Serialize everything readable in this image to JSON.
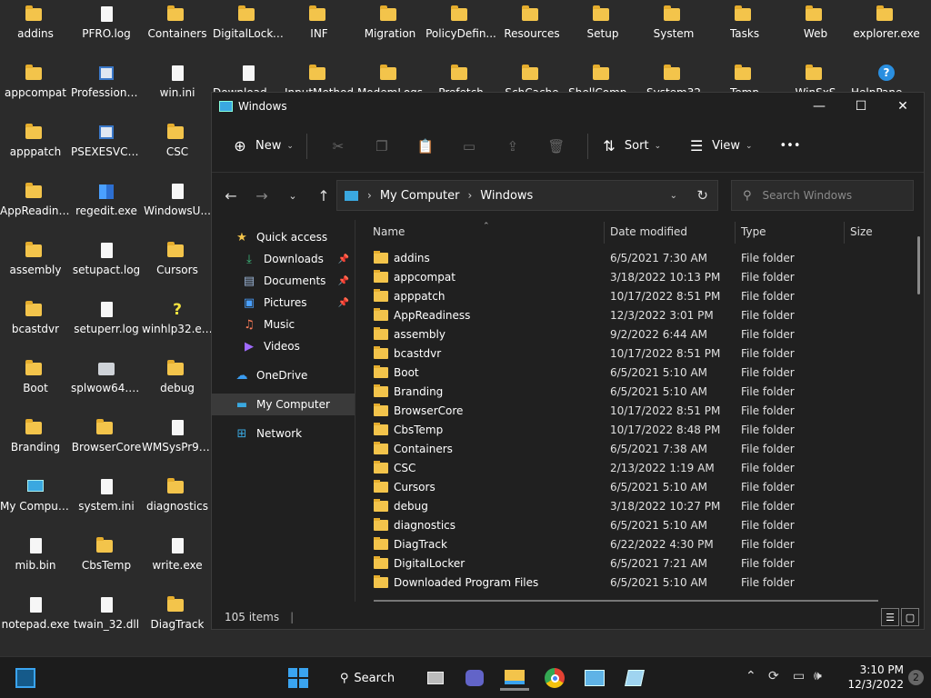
{
  "desktop": {
    "icons": [
      {
        "label": "addins",
        "kind": "folder"
      },
      {
        "label": "PFRO.log",
        "kind": "file"
      },
      {
        "label": "Containers",
        "kind": "folder"
      },
      {
        "label": "DigitalLocker",
        "kind": "folder"
      },
      {
        "label": "INF",
        "kind": "folder"
      },
      {
        "label": "Migration",
        "kind": "folder"
      },
      {
        "label": "PolicyDefin...",
        "kind": "folder"
      },
      {
        "label": "Resources",
        "kind": "folder"
      },
      {
        "label": "Setup",
        "kind": "folder"
      },
      {
        "label": "System",
        "kind": "folder"
      },
      {
        "label": "Tasks",
        "kind": "folder"
      },
      {
        "label": "Web",
        "kind": "folder"
      },
      {
        "label": "explorer.exe",
        "kind": "folder"
      },
      {
        "label": "appcompat",
        "kind": "folder"
      },
      {
        "label": "Professional...",
        "kind": "exe"
      },
      {
        "label": "win.ini",
        "kind": "file"
      },
      {
        "label": "Downloaded...",
        "kind": "file"
      },
      {
        "label": "InputMethod",
        "kind": "folder"
      },
      {
        "label": "ModemLogs",
        "kind": "folder"
      },
      {
        "label": "Prefetch",
        "kind": "folder"
      },
      {
        "label": "SchCache",
        "kind": "folder"
      },
      {
        "label": "ShellComp...",
        "kind": "folder"
      },
      {
        "label": "System32",
        "kind": "folder"
      },
      {
        "label": "Temp",
        "kind": "folder"
      },
      {
        "label": "WinSxS",
        "kind": "folder"
      },
      {
        "label": "HelpPane.exe",
        "kind": "help"
      },
      {
        "label": "apppatch",
        "kind": "folder"
      },
      {
        "label": "PSEXESVC.exe",
        "kind": "exe"
      },
      {
        "label": "CSC",
        "kind": "folder"
      },
      {
        "label": "AppReadiness",
        "kind": "folder"
      },
      {
        "label": "regedit.exe",
        "kind": "regedit"
      },
      {
        "label": "WindowsU...",
        "kind": "file"
      },
      {
        "label": "assembly",
        "kind": "folder"
      },
      {
        "label": "setupact.log",
        "kind": "file"
      },
      {
        "label": "Cursors",
        "kind": "folder"
      },
      {
        "label": "bcastdvr",
        "kind": "folder"
      },
      {
        "label": "setuperr.log",
        "kind": "file"
      },
      {
        "label": "winhlp32.exe",
        "kind": "yq"
      },
      {
        "label": "Boot",
        "kind": "folder"
      },
      {
        "label": "splwow64.exe",
        "kind": "printer"
      },
      {
        "label": "debug",
        "kind": "folder"
      },
      {
        "label": "Branding",
        "kind": "folder"
      },
      {
        "label": "BrowserCore",
        "kind": "folder"
      },
      {
        "label": "WMSysPr9....",
        "kind": "file"
      },
      {
        "label": "My Computer",
        "kind": "pc"
      },
      {
        "label": "system.ini",
        "kind": "file"
      },
      {
        "label": "diagnostics",
        "kind": "folder"
      },
      {
        "label": "mib.bin",
        "kind": "file"
      },
      {
        "label": "CbsTemp",
        "kind": "folder"
      },
      {
        "label": "write.exe",
        "kind": "file"
      },
      {
        "label": "notepad.exe",
        "kind": "file"
      },
      {
        "label": "twain_32.dll",
        "kind": "file"
      },
      {
        "label": "DiagTrack",
        "kind": "folder"
      }
    ]
  },
  "window": {
    "title": "Windows",
    "toolbar": {
      "new_label": "New",
      "sort_label": "Sort",
      "view_label": "View",
      "more_label": "•••"
    },
    "address": {
      "root": "My Computer",
      "current": "Windows"
    },
    "search": {
      "placeholder": "Search Windows"
    },
    "nav": {
      "quick_access": "Quick access",
      "downloads": "Downloads",
      "documents": "Documents",
      "pictures": "Pictures",
      "music": "Music",
      "videos": "Videos",
      "onedrive": "OneDrive",
      "my_computer": "My Computer",
      "network": "Network"
    },
    "columns": {
      "name": "Name",
      "date": "Date modified",
      "type": "Type",
      "size": "Size"
    },
    "files": [
      {
        "name": "addins",
        "date": "6/5/2021 7:30 AM",
        "type": "File folder"
      },
      {
        "name": "appcompat",
        "date": "3/18/2022 10:13 PM",
        "type": "File folder"
      },
      {
        "name": "apppatch",
        "date": "10/17/2022 8:51 PM",
        "type": "File folder"
      },
      {
        "name": "AppReadiness",
        "date": "12/3/2022 3:01 PM",
        "type": "File folder"
      },
      {
        "name": "assembly",
        "date": "9/2/2022 6:44 AM",
        "type": "File folder"
      },
      {
        "name": "bcastdvr",
        "date": "10/17/2022 8:51 PM",
        "type": "File folder"
      },
      {
        "name": "Boot",
        "date": "6/5/2021 5:10 AM",
        "type": "File folder"
      },
      {
        "name": "Branding",
        "date": "6/5/2021 5:10 AM",
        "type": "File folder"
      },
      {
        "name": "BrowserCore",
        "date": "10/17/2022 8:51 PM",
        "type": "File folder"
      },
      {
        "name": "CbsTemp",
        "date": "10/17/2022 8:48 PM",
        "type": "File folder"
      },
      {
        "name": "Containers",
        "date": "6/5/2021 7:38 AM",
        "type": "File folder"
      },
      {
        "name": "CSC",
        "date": "2/13/2022 1:19 AM",
        "type": "File folder"
      },
      {
        "name": "Cursors",
        "date": "6/5/2021 5:10 AM",
        "type": "File folder"
      },
      {
        "name": "debug",
        "date": "3/18/2022 10:27 PM",
        "type": "File folder"
      },
      {
        "name": "diagnostics",
        "date": "6/5/2021 5:10 AM",
        "type": "File folder"
      },
      {
        "name": "DiagTrack",
        "date": "6/22/2022 4:30 PM",
        "type": "File folder"
      },
      {
        "name": "DigitalLocker",
        "date": "6/5/2021 7:21 AM",
        "type": "File folder"
      },
      {
        "name": "Downloaded Program Files",
        "date": "6/5/2021 5:10 AM",
        "type": "File folder"
      }
    ],
    "status": {
      "item_count": "105 items"
    }
  },
  "taskbar": {
    "search_label": "Search",
    "time": "3:10 PM",
    "date": "12/3/2022",
    "notifications": "2"
  }
}
